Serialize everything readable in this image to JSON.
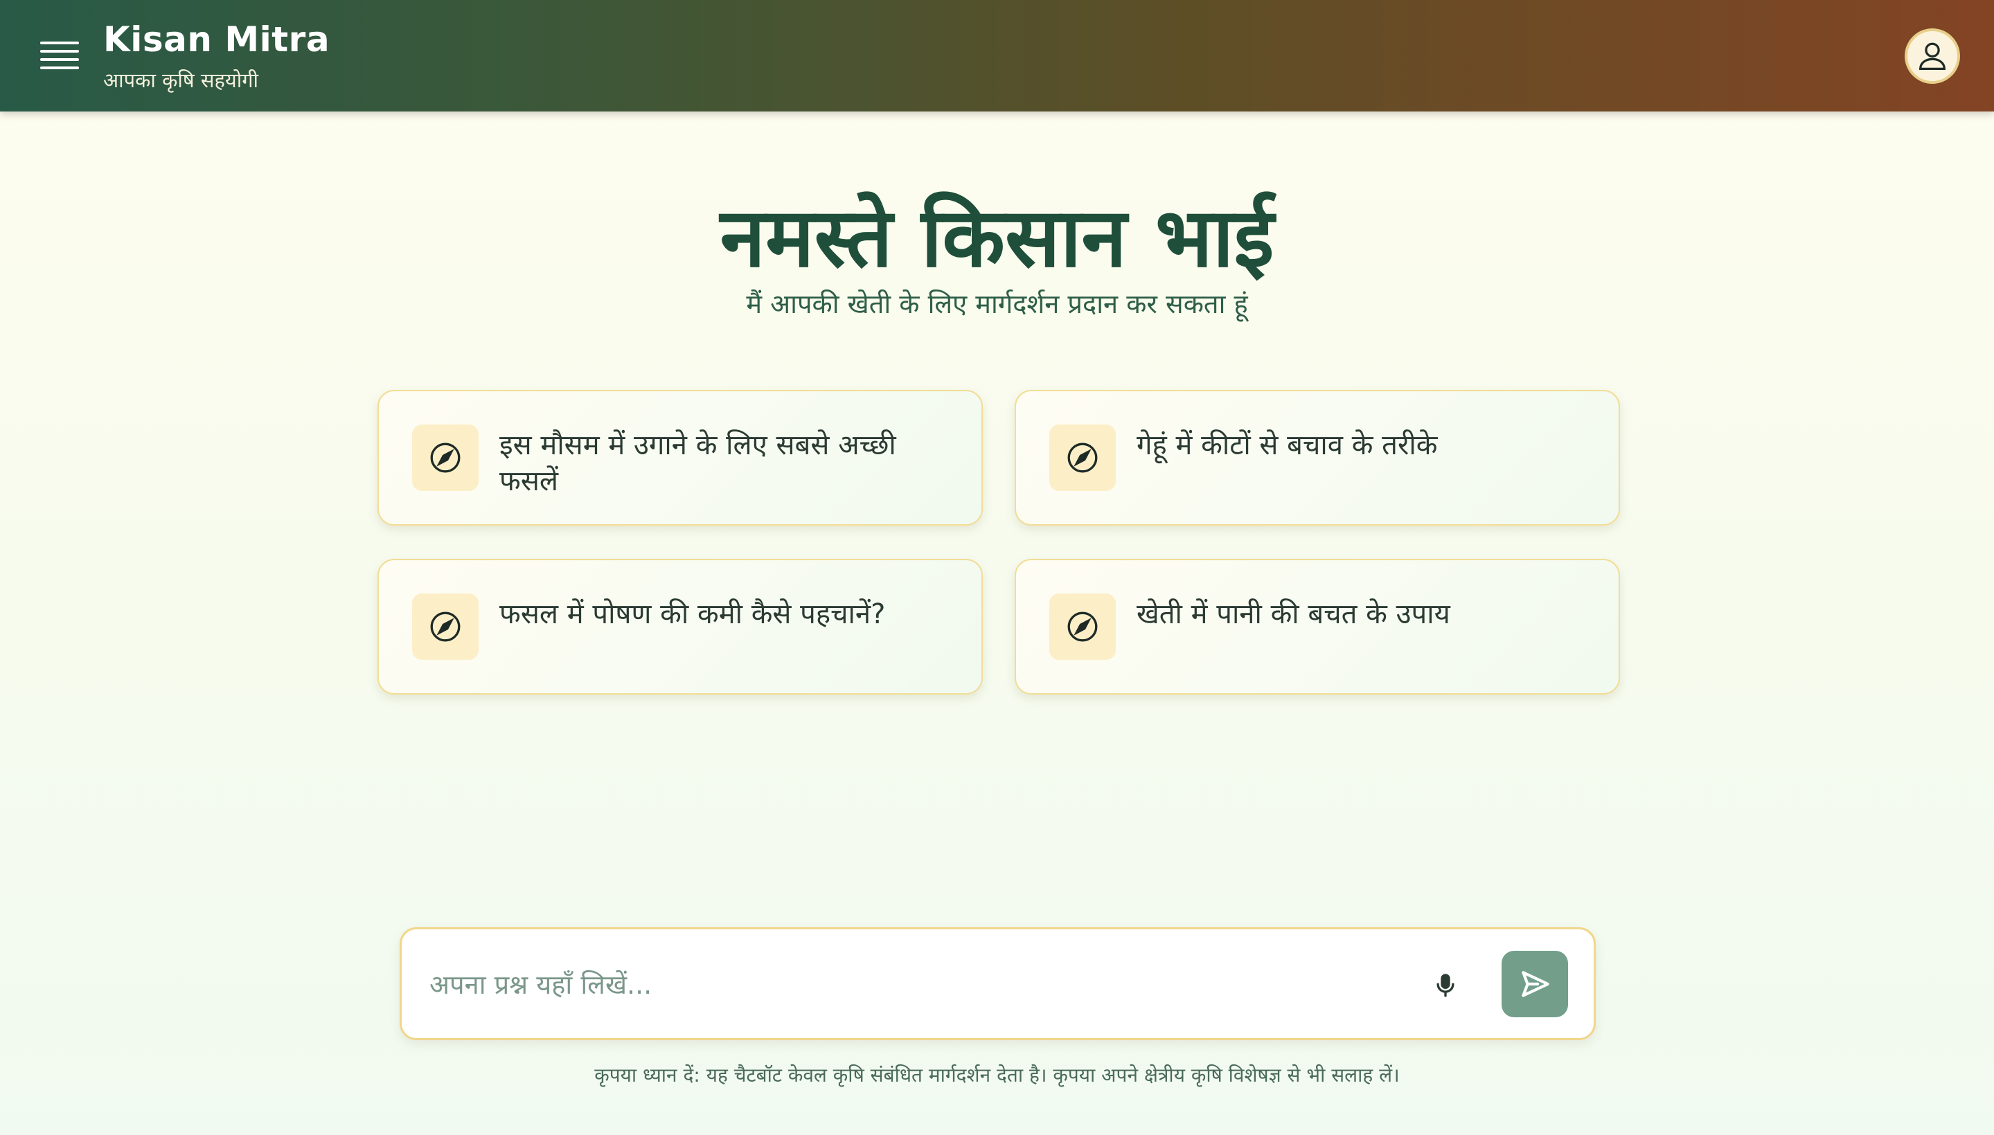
{
  "header": {
    "title": "Kisan Mitra",
    "subtitle": "आपका कृषि सहयोगी",
    "menu_icon": "hamburger-menu-icon",
    "avatar_icon": "user-icon"
  },
  "hero": {
    "title": "नमस्ते किसान भाई",
    "subtitle": "मैं आपकी खेती के लिए मार्गदर्शन प्रदान कर सकता हूं"
  },
  "suggestions": [
    {
      "label": "इस मौसम में उगाने के लिए सबसे अच्छी फसलें",
      "icon": "compass-icon"
    },
    {
      "label": "गेहूं में कीटों से बचाव के तरीके",
      "icon": "compass-icon"
    },
    {
      "label": "फसल में पोषण की कमी कैसे पहचानें?",
      "icon": "compass-icon"
    },
    {
      "label": "खेती में पानी की बचत के उपाय",
      "icon": "compass-icon"
    }
  ],
  "input": {
    "placeholder": "अपना प्रश्न यहाँ लिखें...",
    "value": "",
    "mic_icon": "microphone-icon",
    "send_icon": "send-icon"
  },
  "footer": {
    "disclaimer": "कृपया ध्यान दें: यह चैटबॉट केवल कृषि संबंधित मार्गदर्शन देता है। कृपया अपने क्षेत्रीय कृषि विशेषज्ञ से भी सलाह लें।"
  },
  "colors": {
    "header_gradient_start": "#285a47",
    "header_gradient_end": "#834424",
    "primary_green": "#1f4f3a",
    "card_border": "#f2dd96",
    "icon_bg": "#fcefc8",
    "send_button": "#739f8a"
  }
}
